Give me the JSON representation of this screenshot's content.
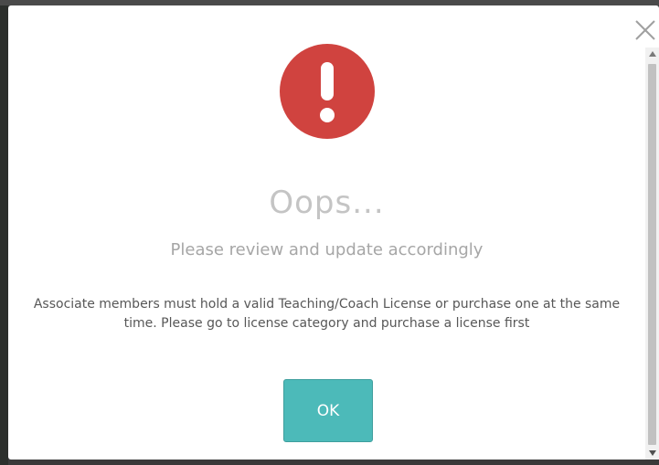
{
  "dialog": {
    "title": "Oops...",
    "subtitle": "Please review and update accordingly",
    "message": "Associate members must hold a valid Teaching/Coach License or purchase one at the same time. Please go to license category and purchase a license first",
    "ok_label": "OK",
    "icon": "error-exclamation-icon",
    "close_icon": "close-icon"
  },
  "colors": {
    "error_icon": "#d0433f",
    "ok_button": "#4cbab9",
    "title_text": "#c4c4c4",
    "subtitle_text": "#a6a6a6",
    "message_text": "#575757"
  }
}
